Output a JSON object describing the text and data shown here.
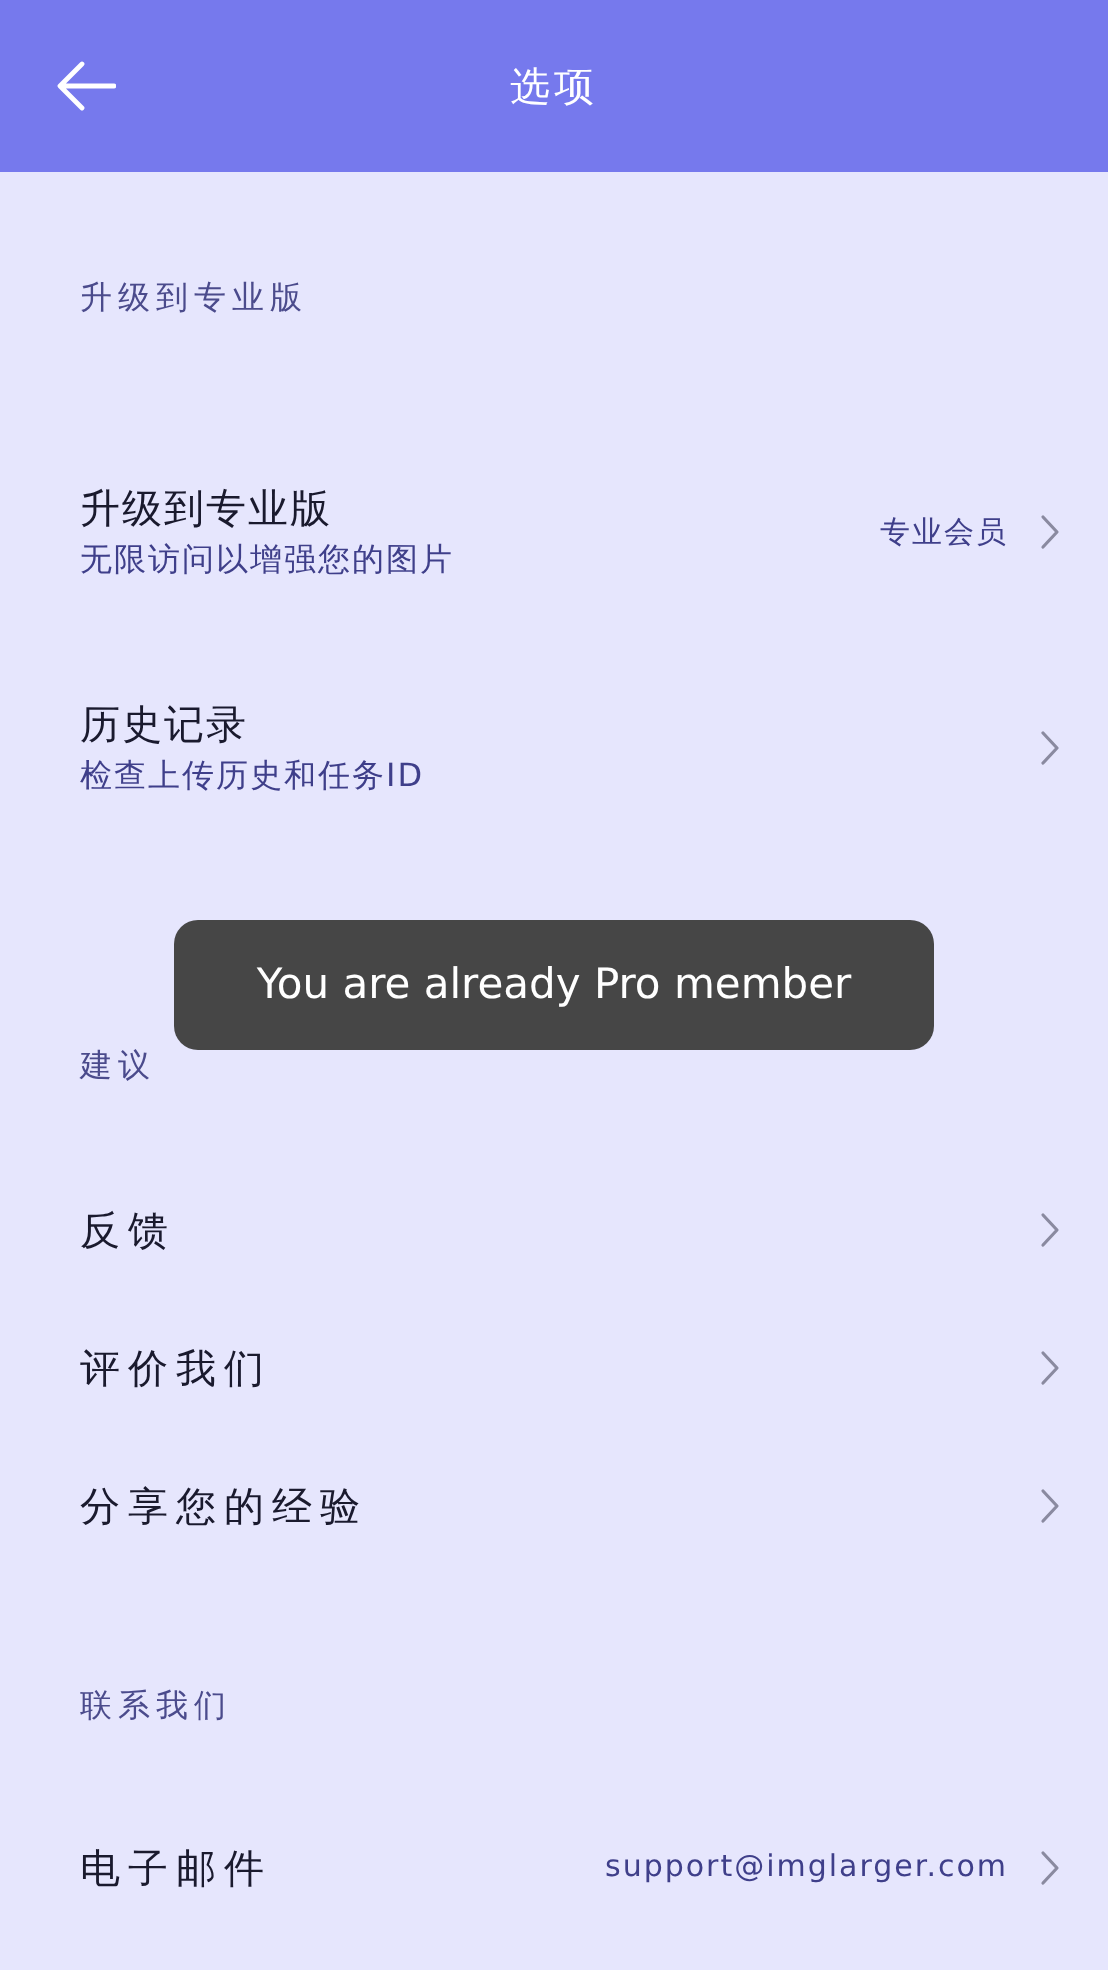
{
  "app_bar": {
    "title": "选项"
  },
  "sections": [
    {
      "title": "升级到专业版",
      "items": [
        {
          "title": "升级到专业版",
          "subtitle": "无限访问以增强您的图片",
          "value": "专业会员"
        },
        {
          "title": "历史记录",
          "subtitle": "检查上传历史和任务ID"
        }
      ]
    },
    {
      "title": "建议",
      "items": [
        {
          "title": "反馈"
        },
        {
          "title": "评价我们"
        },
        {
          "title": "分享您的经验"
        }
      ]
    },
    {
      "title": "联系我们",
      "items": [
        {
          "title": "电子邮件",
          "value": "support@imglarger.com"
        }
      ]
    }
  ],
  "toast": {
    "text": "You are already Pro member"
  }
}
